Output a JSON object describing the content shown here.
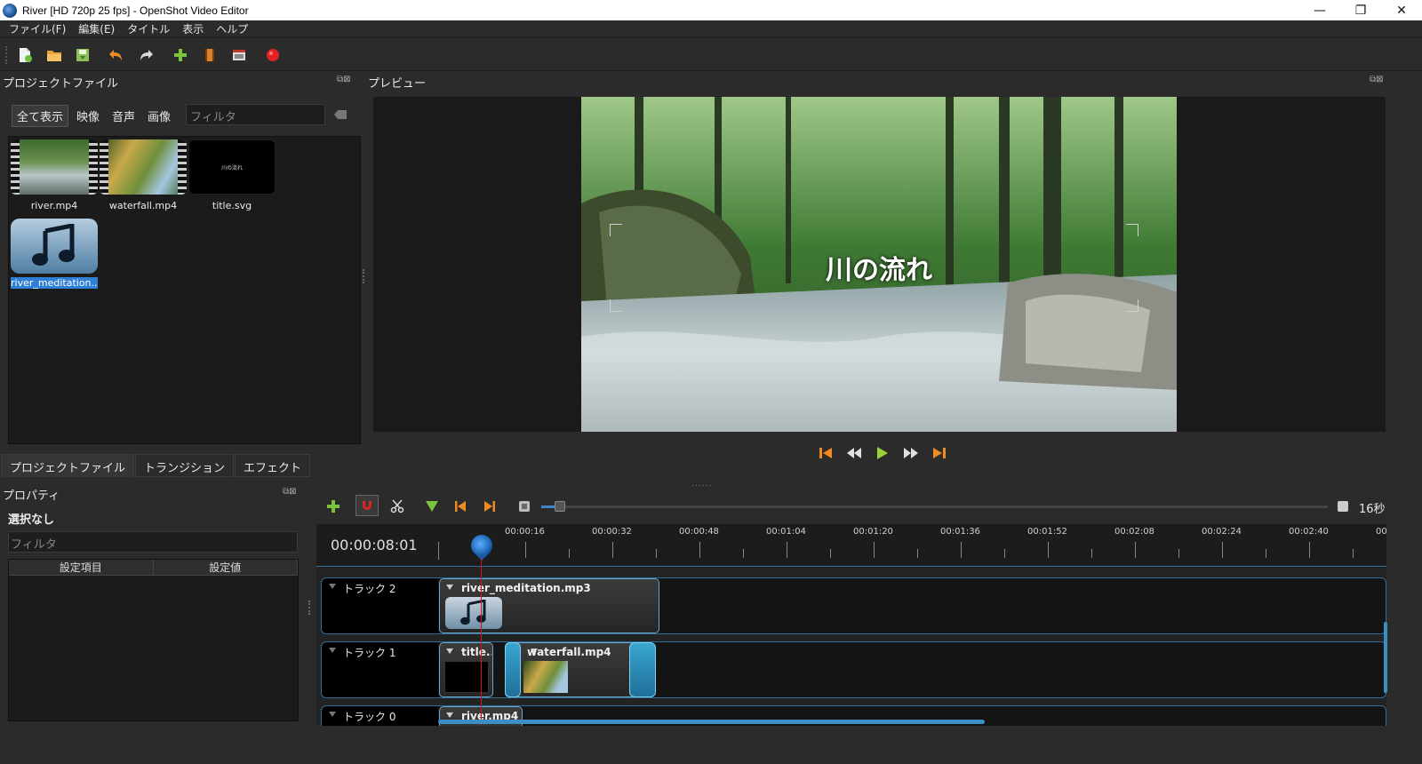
{
  "window": {
    "title": "River [HD 720p 25 fps] - OpenShot Video Editor",
    "buttons": [
      "—",
      "❐",
      "✕"
    ]
  },
  "menu": [
    "ファイル(F)",
    "編集(E)",
    "タイトル",
    "表示",
    "ヘルプ"
  ],
  "toolbar": [
    "new-project-icon",
    "open-project-icon",
    "save-project-icon",
    "undo-icon",
    "redo-icon",
    "import-files-icon",
    "choose-profile-icon",
    "fullscreen-icon",
    "export-video-icon"
  ],
  "project_files": {
    "title": "プロジェクトファイル",
    "filters": [
      "全て表示",
      "映像",
      "音声",
      "画像"
    ],
    "filter_placeholder": "フィルタ",
    "files": [
      {
        "name": "river.mp4"
      },
      {
        "name": "waterfall.mp4"
      },
      {
        "name": "title.svg",
        "thumb_text": "川の流れ"
      },
      {
        "name": "river_meditation..."
      }
    ]
  },
  "left_tabs": [
    "プロジェクトファイル",
    "トランジション",
    "エフェクト"
  ],
  "properties": {
    "title": "プロパティ",
    "selection": "選択なし",
    "filter_placeholder": "フィルタ",
    "columns": [
      "設定項目",
      "設定値"
    ]
  },
  "preview": {
    "title": "プレビュー",
    "overlay_text": "川の流れ"
  },
  "transport": [
    "jump-start-icon",
    "rewind-icon",
    "play-icon",
    "fast-forward-icon",
    "jump-end-icon"
  ],
  "timeline": {
    "zoom_label": "16秒",
    "timecode": "00:00:08:01",
    "ticks": [
      "00:00:16",
      "00:00:32",
      "00:00:48",
      "00:01:04",
      "00:01:20",
      "00:01:36",
      "00:01:52",
      "00:02:08",
      "00:02:24",
      "00:02:40",
      "00:"
    ],
    "tracks": [
      {
        "name": "トラック 2",
        "clips": [
          {
            "name": "river_meditation.mp3"
          }
        ]
      },
      {
        "name": "トラック 1",
        "clips": [
          {
            "name": "title..."
          },
          {
            "name": "waterfall.mp4"
          }
        ]
      },
      {
        "name": "トラック 0",
        "clips": [
          {
            "name": "river.mp4"
          }
        ]
      }
    ]
  },
  "colors": {
    "accent": "#3d87c8",
    "playhead": "#dd1111",
    "clip_border": "#6aa7cf",
    "transition": "#39a6cf"
  }
}
